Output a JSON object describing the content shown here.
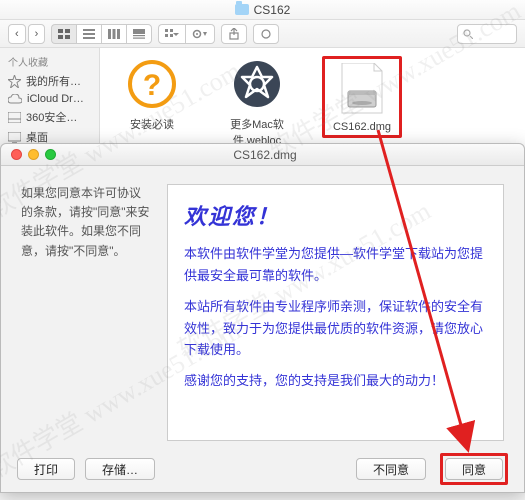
{
  "finder": {
    "title": "CS162",
    "sidebar": {
      "header": "个人收藏",
      "items": [
        {
          "label": "我的所有…",
          "icon": "star"
        },
        {
          "label": "iCloud Dr…",
          "icon": "cloud"
        },
        {
          "label": "360安全…",
          "icon": "disk"
        },
        {
          "label": "桌面",
          "icon": "desktop"
        }
      ]
    },
    "files": [
      {
        "label": "安装必读",
        "icon": "help"
      },
      {
        "label": "更多Mac软件.webloc",
        "icon": "appstore"
      },
      {
        "label": "CS162.dmg",
        "icon": "dmg"
      }
    ]
  },
  "dialog": {
    "title": "CS162.dmg",
    "instructions": "如果您同意本许可协议的条款，请按\"同意\"来安装此软件。如果您不同意，请按\"不同意\"。",
    "license": {
      "heading": "欢迎您！",
      "p1": "本软件由软件学堂为您提供—软件学堂下载站为您提供最安全最可靠的软件。",
      "p2": "本站所有软件由专业程序师亲测，保证软件的安全有效性，致力于为您提供最优质的软件资源，请您放心下载使用。",
      "p3": "感谢您的支持，您的支持是我们最大的动力！"
    },
    "buttons": {
      "print": "打印",
      "save": "存储…",
      "disagree": "不同意",
      "agree": "同意"
    }
  },
  "watermark": "软件学堂 www.xue51.com",
  "colors": {
    "highlight": "#e02020",
    "link_text": "#3433d6"
  }
}
